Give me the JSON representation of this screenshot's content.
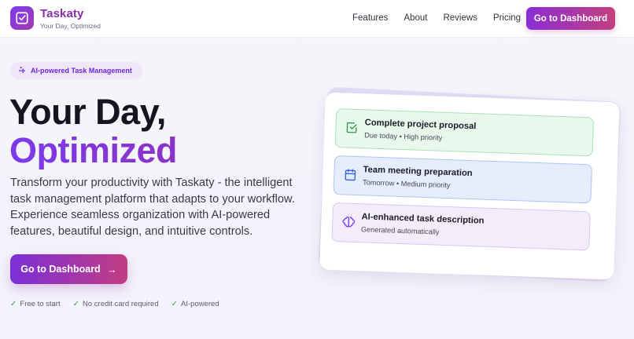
{
  "nav": {
    "brand": "Taskaty",
    "tagline": "Your Day, Optimized",
    "links": [
      "Features",
      "About",
      "Reviews",
      "Pricing"
    ],
    "cta_label": "Go to Dashboard"
  },
  "hero": {
    "badge": "AI-powered Task Management",
    "title_line1": "Your Day,",
    "title_line2": "Optimized",
    "description": "Transform your productivity with Taskaty - the intelligent task management platform that adapts to your workflow. Experience seamless organization with AI-powered features, beautiful design, and intuitive controls.",
    "cta_label": "Go to Dashboard",
    "features": [
      "Free to start",
      "No credit card required",
      "AI-powered"
    ]
  },
  "preview": {
    "tasks": [
      {
        "title": "Complete project proposal",
        "subtitle": "Due today • High priority",
        "icon": "check-square-icon",
        "color": "#e8f8ec"
      },
      {
        "title": "Team meeting preparation",
        "subtitle": "Tomorrow • Medium priority",
        "icon": "calendar-icon",
        "color": "#e5edfb"
      },
      {
        "title": "AI-enhanced task description",
        "subtitle": "Generated automatically",
        "icon": "brain-icon",
        "color": "#f3ecfb"
      }
    ]
  },
  "colors": {
    "brand": "#8a2fa9",
    "accent_start": "#7c3aed",
    "accent_end": "#c33f7d"
  }
}
